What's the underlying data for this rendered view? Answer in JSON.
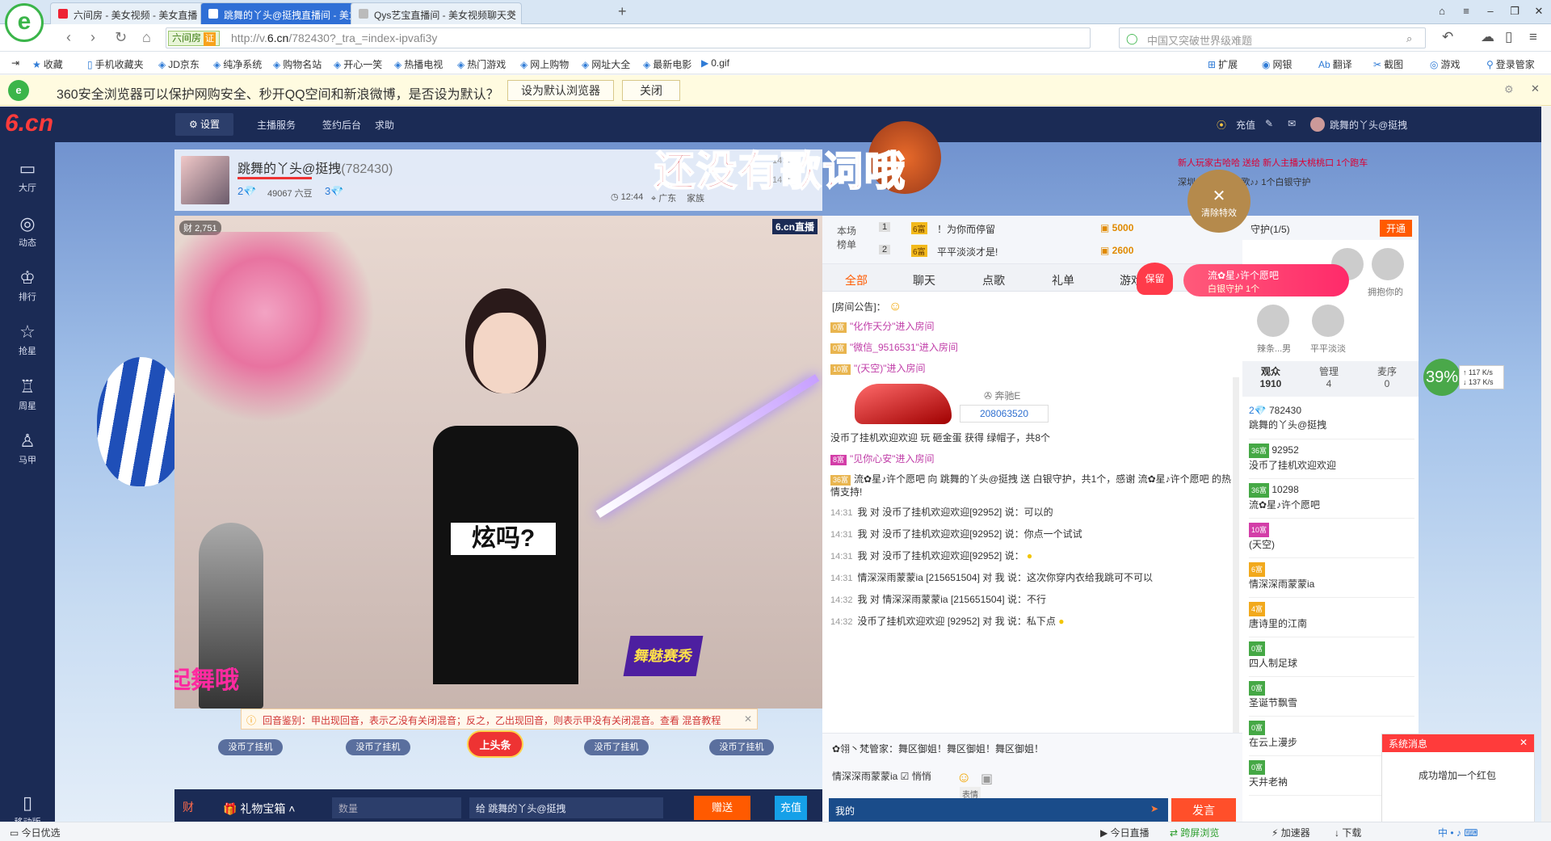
{
  "tabs": [
    {
      "title": "六间房 - 美女视频 - 美女直播 -",
      "active": false
    },
    {
      "title": "跳舞的丫头@挺拽直播间 - 美女视",
      "active": true
    },
    {
      "title": "Qys艺宝直播间 - 美女视频聊天交",
      "active": false
    }
  ],
  "address": {
    "site_tag": "六间房",
    "cert": "证",
    "url_host": "http://v.",
    "url_domain": "6.cn",
    "url_path": "/782430?_tra_=index-ipvafi3y",
    "search_placeholder": "中国又突破世界级难题"
  },
  "favorites": [
    "收藏",
    "手机收藏夹",
    "JD京东",
    "纯净系统",
    "购物名站",
    "开心一笑",
    "热播电视",
    "热门游戏",
    "网上购物",
    "网址大全",
    "最新电影",
    "0.gif"
  ],
  "fav_right": [
    "扩展",
    "网银",
    "翻译",
    "截图",
    "游戏",
    "登录管家"
  ],
  "notice": {
    "text": "360安全浏览器可以保护网购安全、秒开QQ空间和新浪微博，是否设为默认？",
    "set_default": "设为默认浏览器",
    "close": "关闭"
  },
  "site": {
    "brand": "6.cn",
    "settings": "设置",
    "topnav": [
      "主播服务",
      "签约后台",
      "求助"
    ],
    "recharge": "充值",
    "user": "跳舞的丫头@挺拽",
    "leftnav": [
      "大厅",
      "动态",
      "排行",
      "抢星",
      "周星",
      "马甲",
      "移动版"
    ],
    "overlay_title": "还没有歌词哦"
  },
  "anchor": {
    "name": "跳舞的丫头@挺拽",
    "id": "(782430)",
    "level": "2",
    "beans": "49067 六豆",
    "level2": "3",
    "time": "12:44",
    "region": "广东",
    "family": "家族"
  },
  "top_feed": [
    {
      "time": "14:00",
      "text": "新人玩家古哈哈 送给 新人主播大桃桃口 1个跑车"
    },
    {
      "time": "14:00",
      "text": "深圳 跳舞猩❤小歌♪♪ 1个白银守护"
    }
  ],
  "video": {
    "wealth": "2,751",
    "badge": "6.cn直播",
    "notice": "回音鉴别：甲出现回音，表示乙没有关闭混音；反之，乙出现回音，则表示甲没有关闭混音。查看 混音教程",
    "badges": [
      "没币了挂机",
      "没币了挂机",
      "上头条",
      "没币了挂机",
      "没币了挂机"
    ]
  },
  "gift_bar": {
    "label": "礼物宝箱",
    "qty": "数量",
    "to": "给 跳舞的丫头@挺拽",
    "send": "赠送",
    "recharge": "充值"
  },
  "rank": {
    "label": "本场榜单",
    "rows": [
      {
        "n": "1",
        "name": "！为你而停留",
        "gold": "5000"
      },
      {
        "n": "2",
        "name": "平平淡淡才是!",
        "gold": "2600"
      }
    ]
  },
  "chat_tabs": [
    "全部",
    "聊天",
    "点歌",
    "礼单",
    "游戏"
  ],
  "room_notice": "[房间公告]：",
  "messages": [
    {
      "time": "",
      "text": "\"化作天分\"进入房间"
    },
    {
      "time": "",
      "text": "\"微信_9516531\"进入房间"
    },
    {
      "time": "",
      "text": "\"(天空)\"进入房间"
    },
    {
      "time": "",
      "text": "没币了挂机欢迎欢迎 玩 砸金蛋 获得 绿帽子，共8个"
    },
    {
      "time": "",
      "text": "\"见你心安\"进入房间"
    },
    {
      "time": "",
      "text": "流✿星♪许个愿吧 向 跳舞的丫头@挺拽 送 白银守护，共1个，感谢 流✿星♪许个愿吧 的热情支持!"
    },
    {
      "time": "14:31",
      "text": "我 对 没币了挂机欢迎欢迎[92952] 说：可以的"
    },
    {
      "time": "14:31",
      "text": "我 对 没币了挂机欢迎欢迎[92952] 说：你点一个试试"
    },
    {
      "time": "14:31",
      "text": "我 对 没币了挂机欢迎欢迎[92952] 说："
    },
    {
      "time": "14:31",
      "text": "情深深雨蒙蒙ia [215651504] 对 我 说：这次你穿内衣给我跳可不可以"
    },
    {
      "time": "14:32",
      "text": "我 对 情深深雨蒙蒙ia [215651504] 说：不行"
    },
    {
      "time": "14:32",
      "text": "没币了挂机欢迎欢迎 [92952] 对 我 说：私下点"
    }
  ],
  "car": {
    "brand": "奔驰E",
    "number": "208063520"
  },
  "announce": "✿翎丶梵管家：舞区御姐！舞区御姐！舞区御姐！",
  "chat_input": {
    "from": "情深深雨蒙蒙ia",
    "quiet": "悄悄",
    "tip": "表情",
    "placeholder": "我的",
    "send": "发言"
  },
  "floating": {
    "close": "清除特效",
    "keep": "保留",
    "promo_title": "流✿星♪许个愿吧",
    "promo_sub": "白银守护 1个"
  },
  "guard": {
    "title": "守护(1/5)",
    "open": "开通",
    "members": [
      "拥抱你的",
      "辣条",
      "男",
      "平平淡淡"
    ]
  },
  "viewer_tabs": [
    {
      "label": "观众",
      "count": "1910"
    },
    {
      "label": "管理",
      "count": "4"
    },
    {
      "label": "麦序",
      "count": "0"
    }
  ],
  "viewers": [
    {
      "id": "782430",
      "name": "跳舞的丫头@挺拽",
      "lv": "2"
    },
    {
      "id": "92952",
      "name": "没币了挂机欢迎欢迎",
      "lv": "36"
    },
    {
      "id": "10298",
      "name": "流✿星♪许个愿吧",
      "lv": "36"
    },
    {
      "id": "",
      "name": "(天空)",
      "lv": "10"
    },
    {
      "id": "",
      "name": "情深深雨蒙蒙ia",
      "lv": "6"
    },
    {
      "id": "",
      "name": "唐诗里的江南",
      "lv": "4"
    },
    {
      "id": "",
      "name": "四人制足球",
      "lv": "0"
    },
    {
      "id": "",
      "name": "圣诞节飘雪",
      "lv": "0"
    },
    {
      "id": "",
      "name": "在云上漫步",
      "lv": "0"
    },
    {
      "id": "",
      "name": "天井老衲",
      "lv": "0"
    }
  ],
  "speed": {
    "pct": "39",
    "up": "117 K/s",
    "down": "137 K/s"
  },
  "sysmsg": {
    "title": "系统消息",
    "body": "成功增加一个红包"
  },
  "status": {
    "left": "今日优选",
    "items": [
      "今日直播",
      "跨屏浏览",
      "加速器",
      "下载"
    ]
  }
}
